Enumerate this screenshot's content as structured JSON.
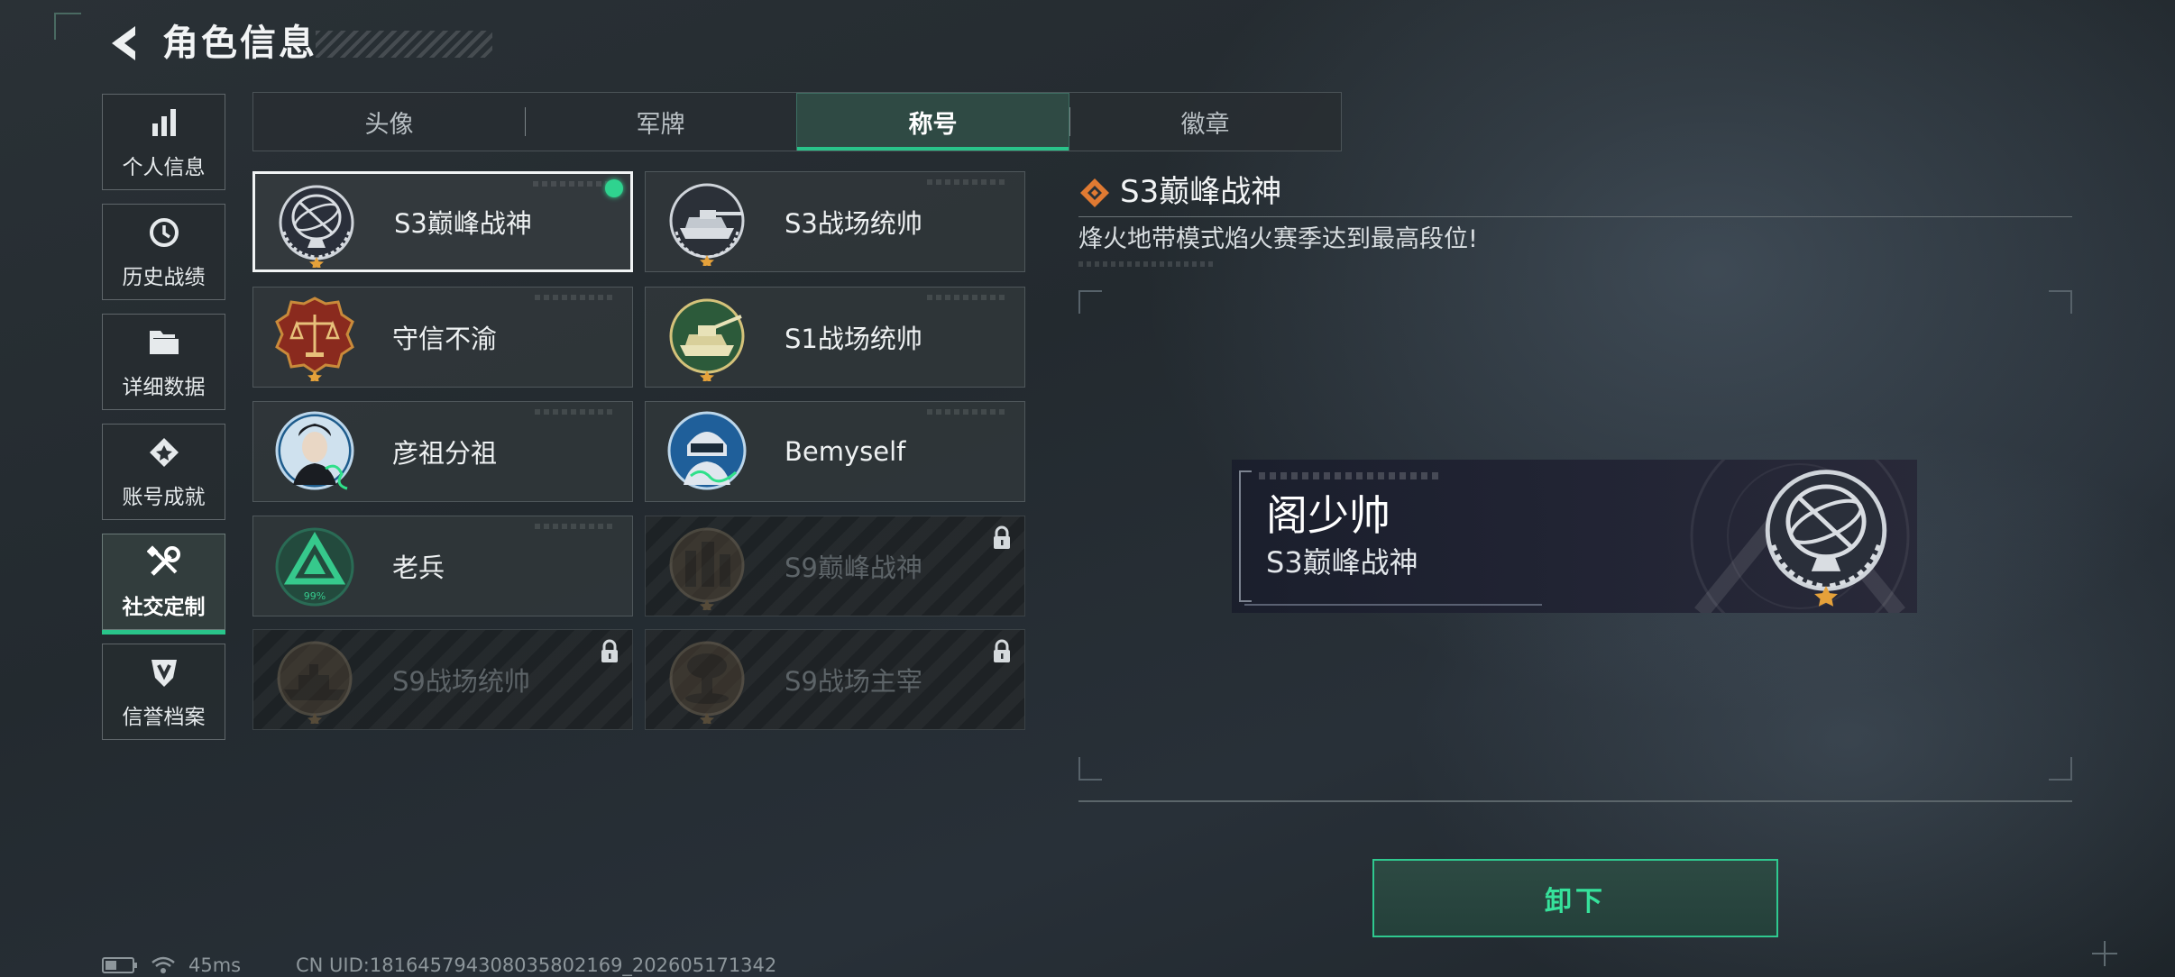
{
  "header": {
    "title": "角色信息"
  },
  "sidebar": {
    "items": [
      {
        "label": "个人信息",
        "icon": "bar-chart-icon",
        "active": false
      },
      {
        "label": "历史战绩",
        "icon": "history-clock-icon",
        "active": false
      },
      {
        "label": "详细数据",
        "icon": "folder-icon",
        "active": false
      },
      {
        "label": "账号成就",
        "icon": "achievement-icon",
        "active": false
      },
      {
        "label": "社交定制",
        "icon": "tools-icon",
        "active": true
      },
      {
        "label": "信誉档案",
        "icon": "reputation-shield-icon",
        "active": false
      }
    ]
  },
  "tabs": [
    {
      "label": "头像",
      "active": false
    },
    {
      "label": "军牌",
      "active": false
    },
    {
      "label": "称号",
      "active": true
    },
    {
      "label": "徽章",
      "active": false
    }
  ],
  "titles": [
    {
      "label": "S3巅峰战神",
      "state": "selected",
      "emblem": "armillary-sphere-emblem-icon"
    },
    {
      "label": "S3战场统帅",
      "state": "owned",
      "emblem": "tank-emblem-icon"
    },
    {
      "label": "守信不渝",
      "state": "owned",
      "emblem": "scales-emblem-icon"
    },
    {
      "label": "S1战场统帅",
      "state": "owned",
      "emblem": "green-tank-emblem-icon"
    },
    {
      "label": "彦祖分祖",
      "state": "owned",
      "emblem": "portrait-signature-emblem-icon"
    },
    {
      "label": "Bemyself",
      "state": "owned",
      "emblem": "soldier-signature-emblem-icon"
    },
    {
      "label": "老兵",
      "state": "owned",
      "emblem": "veteran-triangle-emblem-icon",
      "emblem_text": "99%"
    },
    {
      "label": "S9巅峰战神",
      "state": "locked",
      "emblem": "ruins-emblem-icon"
    },
    {
      "label": "S9战场统帅",
      "state": "locked",
      "emblem": "warship-emblem-icon"
    },
    {
      "label": "S9战场主宰",
      "state": "locked",
      "emblem": "mushroom-cloud-emblem-icon"
    }
  ],
  "detail": {
    "title": "S3巅峰战神",
    "description": "烽火地带模式焰火赛季达到最高段位!"
  },
  "preview": {
    "player_name": "阁少帅",
    "title": "S3巅峰战神"
  },
  "actions": {
    "unequip_label": "卸下"
  },
  "status": {
    "latency": "45ms",
    "uid": "CN UID:181645794308035802169_202605171342"
  },
  "colors": {
    "accent": "#29c48a",
    "selected_dot": "#2fd38f",
    "background": "#262d32"
  }
}
